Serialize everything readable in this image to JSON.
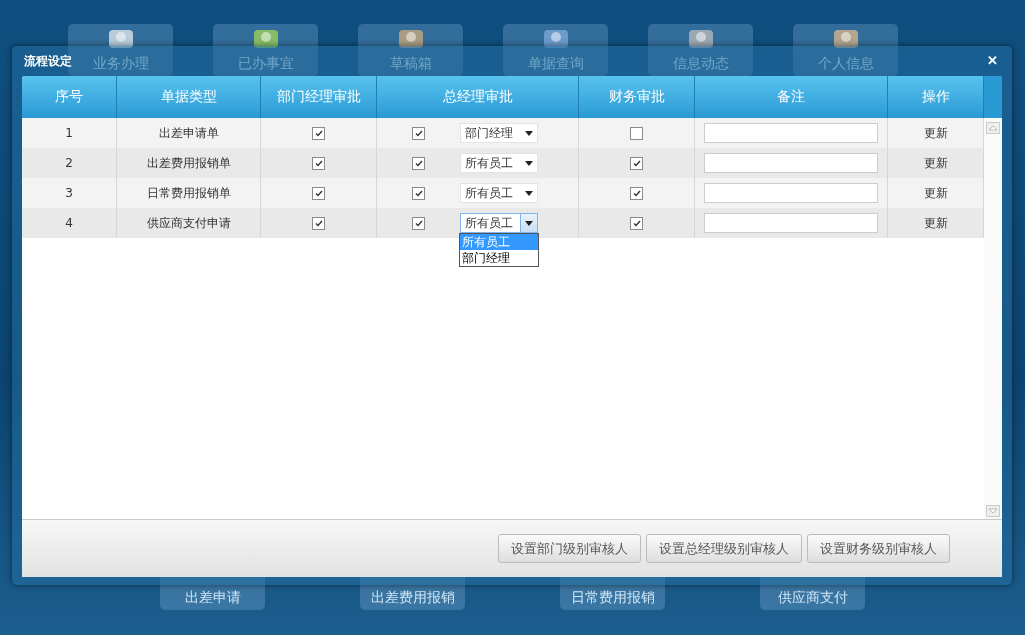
{
  "background_tiles_top": [
    {
      "label": "业务办理"
    },
    {
      "label": "已办事宜"
    },
    {
      "label": "草稿箱"
    },
    {
      "label": "单据查询"
    },
    {
      "label": "信息动态"
    },
    {
      "label": "个人信息"
    }
  ],
  "background_tiles_bottom": [
    {
      "label": "出差申请"
    },
    {
      "label": "出差费用报销"
    },
    {
      "label": "日常费用报销"
    },
    {
      "label": "供应商支付"
    }
  ],
  "dialog": {
    "title": "流程设定",
    "close": "✕"
  },
  "table": {
    "columns": [
      "序号",
      "单据类型",
      "部门经理审批",
      "总经理审批",
      "财务审批",
      "备注",
      "操作"
    ],
    "rows": [
      {
        "no": "1",
        "type": "出差申请单",
        "dept_checked": true,
        "gm_checked": true,
        "gm_select": {
          "value": "部门经理",
          "open": false
        },
        "finance_checked": false,
        "action": "更新"
      },
      {
        "no": "2",
        "type": "出差费用报销单",
        "dept_checked": true,
        "gm_checked": true,
        "gm_select": {
          "value": "所有员工",
          "open": false
        },
        "finance_checked": true,
        "action": "更新"
      },
      {
        "no": "3",
        "type": "日常费用报销单",
        "dept_checked": true,
        "gm_checked": true,
        "gm_select": {
          "value": "所有员工",
          "open": false
        },
        "finance_checked": true,
        "action": "更新"
      },
      {
        "no": "4",
        "type": "供应商支付申请",
        "dept_checked": true,
        "gm_checked": true,
        "gm_select": {
          "value": "所有员工",
          "open": true,
          "options": [
            {
              "label": "所有员工",
              "selected": true
            },
            {
              "label": "部门经理",
              "selected": false
            }
          ]
        },
        "finance_checked": true,
        "action": "更新"
      }
    ]
  },
  "buttons": [
    "设置部门级别审核人",
    "设置总经理级别审核人",
    "设置财务级别审核人"
  ]
}
